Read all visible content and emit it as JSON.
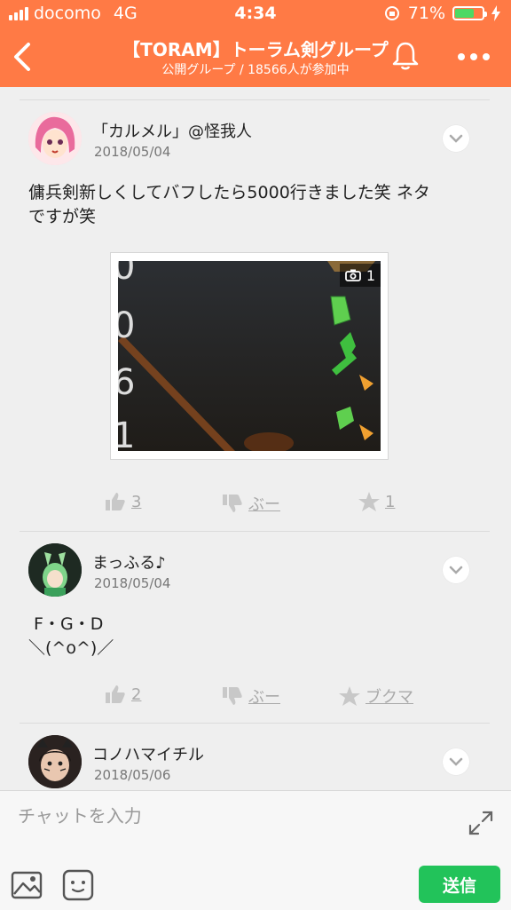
{
  "status": {
    "carrier": "docomo",
    "network": "4G",
    "time": "4:34",
    "battery": "71%",
    "battery_level": 0.71
  },
  "header": {
    "title": "【TORAM】トーラム剣グループ",
    "subtitle": "公開グループ / 18566人が参加中",
    "accent": "#ff7a45"
  },
  "posts": [
    {
      "author": "「カルメル」@怪我人",
      "date": "2018/05/04",
      "text_line1": "傭兵剣新しくしてバフしたら5000行きました笑 ネタ",
      "text_line2": "ですが笑",
      "photo_count": "1",
      "like_count": "3",
      "boo_label": "ぶー",
      "bookmark_count": "1"
    },
    {
      "author": "まっふる♪",
      "date": "2018/05/04",
      "text_line1": " F・G・D",
      "text_line2": "＼(^o^)／",
      "like_count": "2",
      "boo_label": "ぶー",
      "bookmark_label": "ブクマ"
    },
    {
      "author": "コノハマイチル",
      "date": "2018/05/06"
    }
  ],
  "composer": {
    "placeholder": "チャットを入力",
    "send_label": "送信",
    "send_color": "#22c35a"
  },
  "icons": [
    "signal-icon",
    "battery-icon",
    "lock-rotation-icon",
    "back-icon",
    "bell-icon",
    "more-icon",
    "chevron-down-icon",
    "thumbs-up-icon",
    "thumbs-down-icon",
    "star-icon",
    "camera-icon",
    "expand-icon",
    "image-icon",
    "emoji-icon"
  ]
}
